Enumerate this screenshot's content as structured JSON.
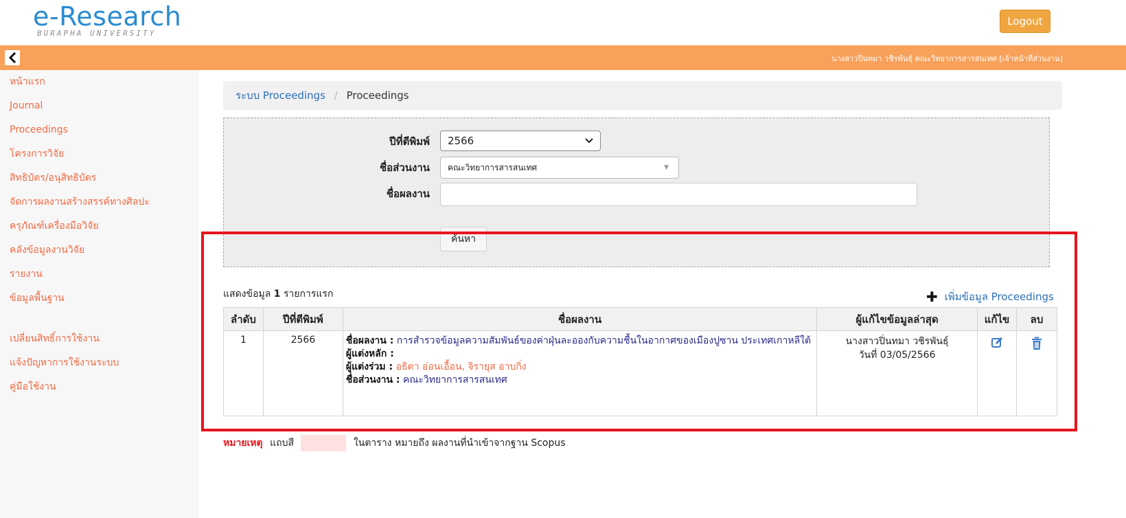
{
  "header": {
    "logo_main": "e-Research",
    "logo_sub": "BURAPHA UNIVERSITY",
    "logout_label": "Logout"
  },
  "topbar": {
    "user_info": "นางสาวปิ่นทมา วชิรพันธุ์  คณะวิทยาการสารสนเทศ  [เจ้าหน้าที่ส่วนงาน]"
  },
  "sidebar": {
    "items": [
      {
        "label": "หน้าแรก"
      },
      {
        "label": "Journal"
      },
      {
        "label": "Proceedings"
      },
      {
        "label": "โครงการวิจัย"
      },
      {
        "label": "สิทธิบัตร/อนุสิทธิบัตร"
      },
      {
        "label": "จัดการผลงานสร้างสรรค์ทางศิลปะ"
      },
      {
        "label": "ครุภัณฑ์เครื่องมือวิจัย"
      },
      {
        "label": "คลังข้อมูลงานวิจัย"
      },
      {
        "label": "รายงาน"
      },
      {
        "label": "ข้อมูลพื้นฐาน"
      }
    ],
    "items2": [
      {
        "label": "เปลี่ยนสิทธิ์การใช้งาน"
      },
      {
        "label": "แจ้งปัญหาการใช้งานระบบ"
      },
      {
        "label": "คู่มือใช้งาน"
      }
    ]
  },
  "breadcrumb": {
    "link": "ระบบ Proceedings",
    "separator": "/",
    "current": "Proceedings"
  },
  "search": {
    "year_label": "ปีที่ตีพิมพ์",
    "year_value": "2566",
    "unit_label": "ชื่อส่วนงาน",
    "unit_value": "คณะวิทยาการสารสนเทศ",
    "name_label": "ชื่อผลงาน",
    "name_value": "",
    "search_button": "ค้นหา"
  },
  "results": {
    "count_prefix": "แสดงข้อมูล",
    "count": "1",
    "count_suffix": "รายการแรก",
    "add_label": "เพิ่มข้อมูล Proceedings",
    "columns": [
      "ลำดับ",
      "ปีที่ตีพิมพ์",
      "ชื่อผลงาน",
      "ผู้แก้ไขข้อมูลล่าสุด",
      "แก้ไข",
      "ลบ"
    ],
    "rows": [
      {
        "no": "1",
        "year": "2566",
        "title_label": "ชื่อผลงาน :",
        "title": "การสำรวจข้อมูลความสัมพันธ์ของค่าฝุ่นละอองกับความชื้นในอากาศของเมืองปูซาน ประเทศเกาหลีใต้",
        "main_author_label": "ผู้แต่งหลัก :",
        "main_author": "",
        "coauthor_label": "ผู้แต่งร่วม :",
        "coauthors": "อธิตา อ่อนเอื้อน, จิรายุส อาบกิ่ง",
        "unit_label": "ชื่อส่วนงาน :",
        "unit": "คณะวิทยาการสารสนเทศ",
        "editor_name": "นางสาวปิ่นทมา วชิรพันธุ์",
        "editor_date": "วันที่ 03/05/2566"
      }
    ]
  },
  "note": {
    "label": "หมายเหตุ",
    "text_before": "แถบสี",
    "text_after": "ในตาราง หมายถึง ผลงานที่นำเข้าจากฐาน Scopus",
    "swatch_color": "#fde0e0"
  },
  "colors": {
    "brand": "#2a8bd0",
    "accent_orange": "#f8a15a",
    "logout": "#f0a640",
    "link": "#2c6fb5",
    "sidebar_link": "#f06a44",
    "highlight_frame": "#e8151c"
  },
  "icons": [
    "chevron-left-icon",
    "chevron-down-icon",
    "plus-icon",
    "edit-icon",
    "trash-icon"
  ]
}
